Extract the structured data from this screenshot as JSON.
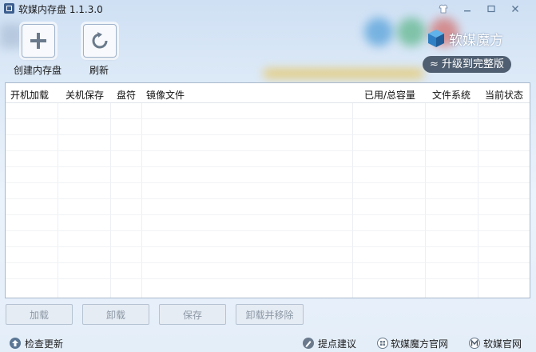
{
  "window": {
    "title": "软媒内存盘 1.1.3.0"
  },
  "toolbar": {
    "create_label": "创建内存盘",
    "refresh_label": "刷新"
  },
  "brand": {
    "logo_text": "软媒魔方",
    "upgrade_label": "升级到完整版"
  },
  "table": {
    "columns": [
      "开机加载",
      "关机保存",
      "盘符",
      "镜像文件",
      "已用/总容量",
      "文件系统",
      "当前状态"
    ],
    "rows": []
  },
  "actions": {
    "load": "加载",
    "unload": "卸载",
    "save": "保存",
    "unload_remove": "卸载并移除"
  },
  "footer": {
    "check_update": "检查更新",
    "feedback": "提点建议",
    "magic_site": "软媒魔方官网",
    "ruanmei_site": "软媒官网"
  },
  "colors": {
    "accent": "#4f5e70",
    "grid_border": "#a9b9cc",
    "disabled_text": "#8c98a6"
  }
}
